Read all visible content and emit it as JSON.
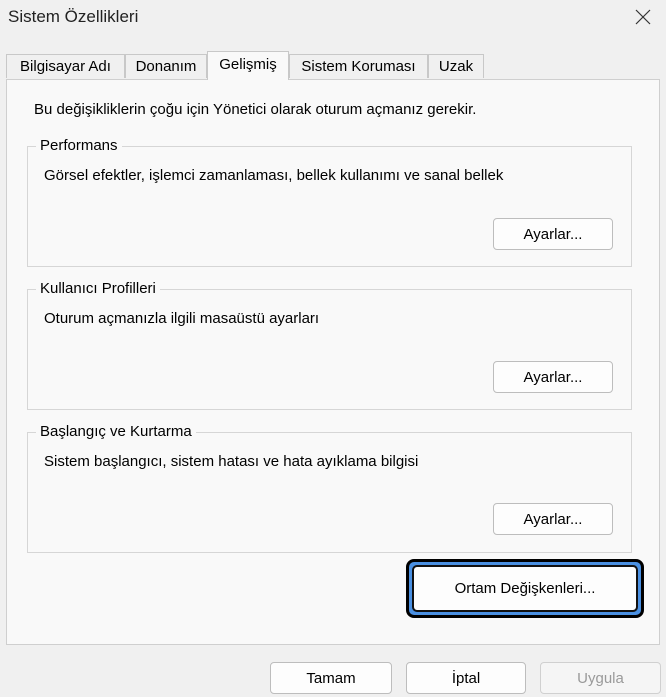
{
  "window": {
    "title": "Sistem Özellikleri",
    "close_icon": "close-icon"
  },
  "tabs": [
    {
      "label": "Bilgisayar Adı",
      "active": false
    },
    {
      "label": "Donanım",
      "active": false
    },
    {
      "label": "Gelişmiş",
      "active": true
    },
    {
      "label": "Sistem Koruması",
      "active": false
    },
    {
      "label": "Uzak",
      "active": false
    }
  ],
  "panel": {
    "notice": "Bu değişikliklerin çoğu için Yönetici olarak oturum açmanız gerekir.",
    "groups": [
      {
        "title": "Performans",
        "description": "Görsel efektler, işlemci zamanlaması, bellek kullanımı ve sanal bellek",
        "button": "Ayarlar..."
      },
      {
        "title": "Kullanıcı Profilleri",
        "description": "Oturum açmanızla ilgili masaüstü ayarları",
        "button": "Ayarlar..."
      },
      {
        "title": "Başlangıç ve Kurtarma",
        "description": "Sistem başlangıcı, sistem hatası ve hata ayıklama bilgisi",
        "button": "Ayarlar..."
      }
    ],
    "env_button": "Ortam Değişkenleri..."
  },
  "footer": {
    "ok": "Tamam",
    "cancel": "İptal",
    "apply": "Uygula"
  },
  "colors": {
    "focus_accent": "#4a90e2"
  }
}
